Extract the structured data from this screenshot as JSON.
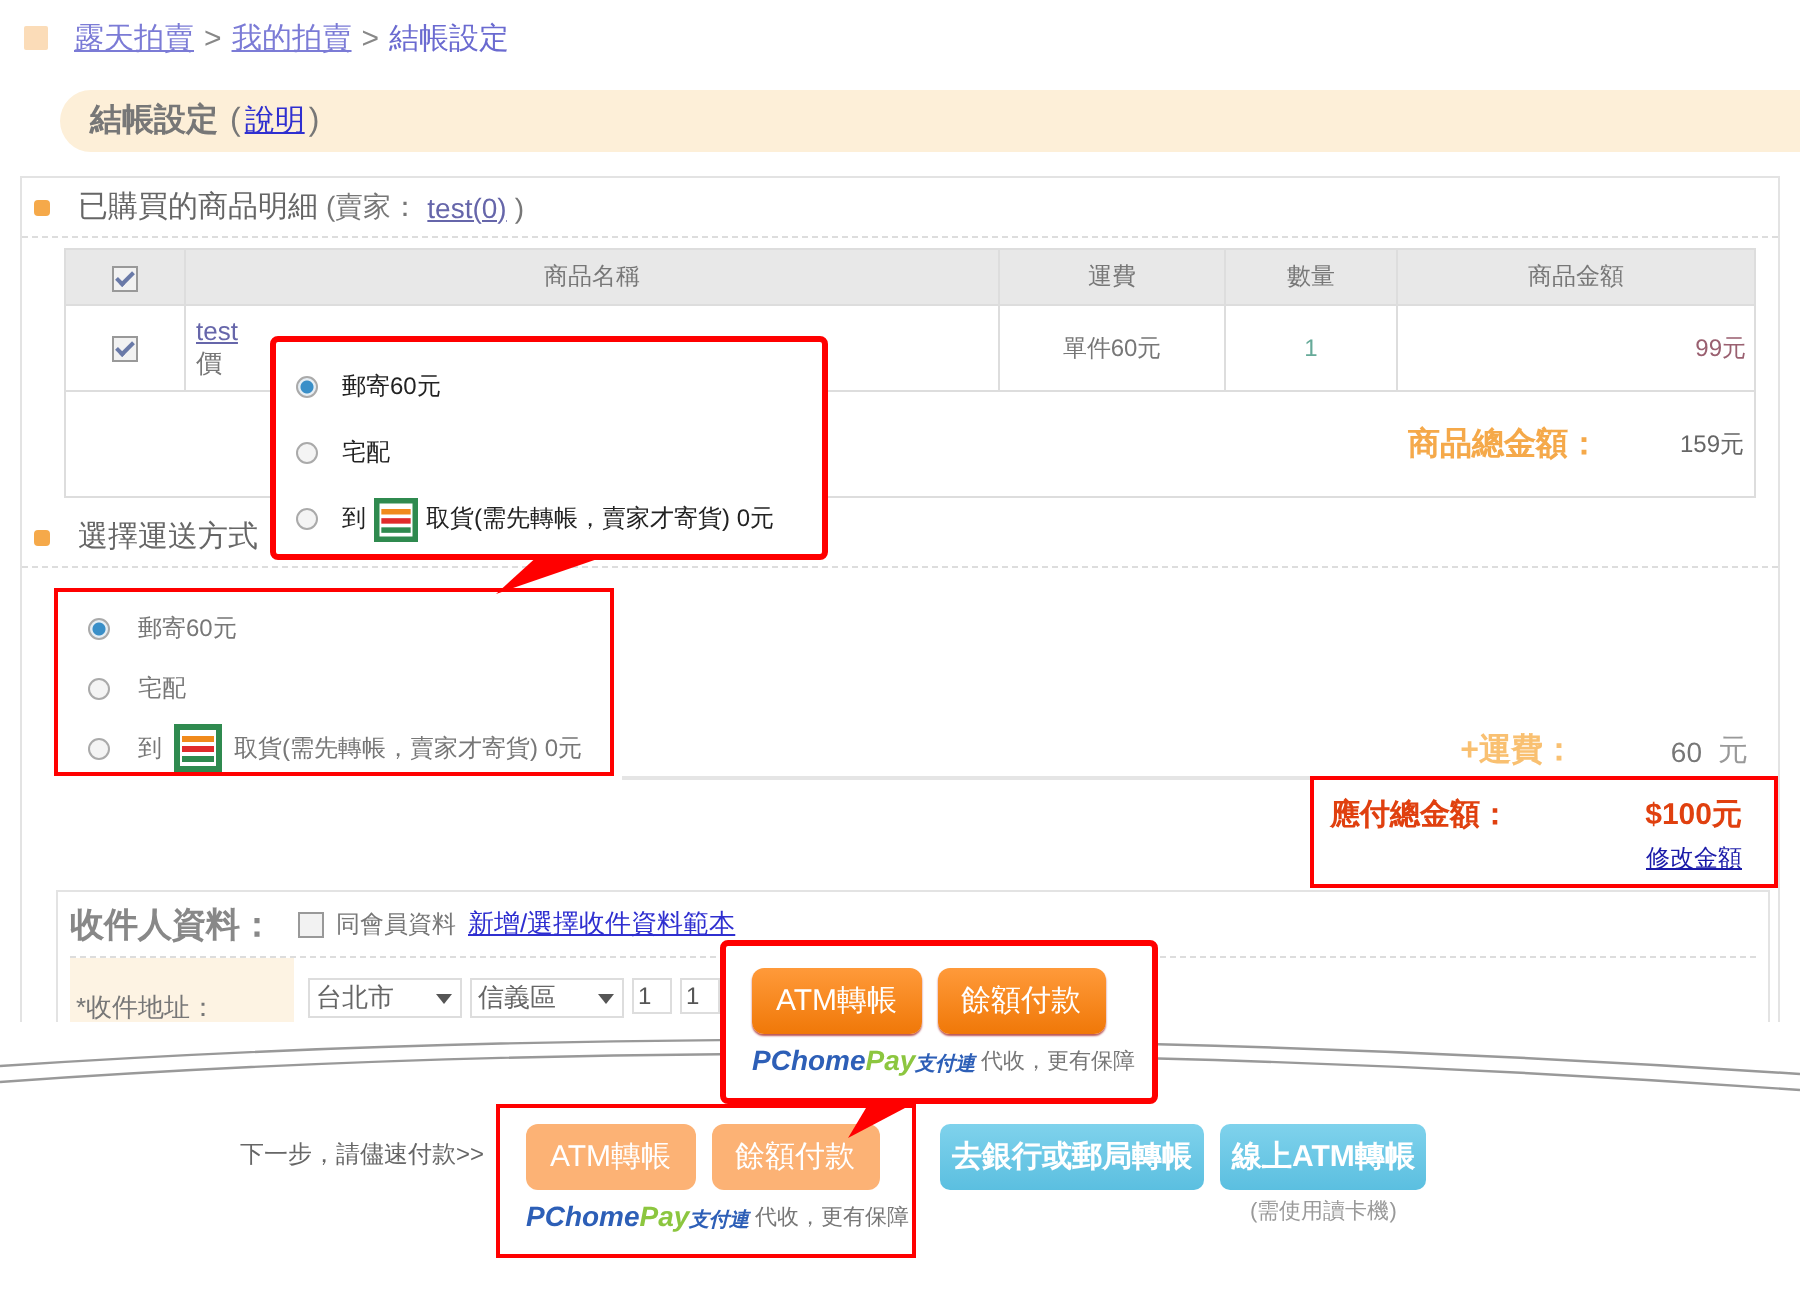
{
  "breadcrumb": [
    {
      "label": "露天拍賣",
      "kind": "link"
    },
    {
      "label": ">",
      "kind": "separator"
    },
    {
      "label": "我的拍賣",
      "kind": "link"
    },
    {
      "label": ">",
      "kind": "separator"
    },
    {
      "label": "結帳設定",
      "kind": "current"
    }
  ],
  "page_title": {
    "title": "結帳設定",
    "help_open": "(",
    "help_link": "說明",
    "help_close": ")"
  },
  "items_section": {
    "title": "已購買的商品明細",
    "seller_open": "(賣家：",
    "seller_link": "test(0)",
    "seller_close": ")"
  },
  "table": {
    "header_checked": true,
    "columns": [
      "商品名稱",
      "運費",
      "數量",
      "商品金額"
    ],
    "rows": [
      {
        "checked": true,
        "name": "test",
        "detail": "價",
        "shipping": "單件60元",
        "quantity": "1",
        "amount": "99元"
      }
    ],
    "subtotal": {
      "label": "商品總金額：",
      "value": "159元"
    }
  },
  "shipping_section": {
    "title": "選擇運送方式",
    "options": [
      {
        "kind": "plain",
        "label": "郵寄60元",
        "selected": true
      },
      {
        "kind": "plain",
        "label": "宅配",
        "selected": false
      },
      {
        "kind": "store",
        "prefix": "到",
        "label": "取貨(需先轉帳，賣家才寄貨) 0元",
        "selected": false
      }
    ]
  },
  "shipping_fee": {
    "label": "+運費：",
    "value": "60",
    "unit": "元"
  },
  "total": {
    "label": "應付總金額：",
    "value": "$100元",
    "link": "修改金額"
  },
  "recipient": {
    "title": "收件人資料：",
    "same_as_member": {
      "label": "同會員資料",
      "checked": false
    },
    "template_link": "新增/選擇收件資料範本",
    "address_label": "*收件地址：",
    "city": "台北市",
    "district": "信義區",
    "inputs": [
      "1",
      "1"
    ]
  },
  "payment": {
    "prompt": "下一步，請儘速付款>>",
    "pchome_buttons": [
      "ATM轉帳",
      "餘額付款"
    ],
    "logo": [
      "PChome",
      "Pay",
      "支付連"
    ],
    "tagline": "代收，更有保障",
    "other_buttons": [
      {
        "label": "去銀行或郵局轉帳"
      },
      {
        "label": "線上ATM轉帳",
        "note": "(需使用讀卡機)"
      }
    ]
  },
  "callouts": {
    "shipping": {
      "options": [
        {
          "kind": "plain",
          "label": "郵寄60元",
          "selected": true
        },
        {
          "kind": "plain",
          "label": "宅配",
          "selected": false
        },
        {
          "kind": "store",
          "prefix": "到",
          "label": "取貨(需先轉帳，賣家才寄貨) 0元",
          "selected": false
        }
      ]
    },
    "payment": {
      "buttons": [
        "ATM轉帳",
        "餘額付款"
      ],
      "logo": [
        "PChome",
        "Pay",
        "支付連"
      ],
      "tagline": "代收，更有保障"
    }
  }
}
